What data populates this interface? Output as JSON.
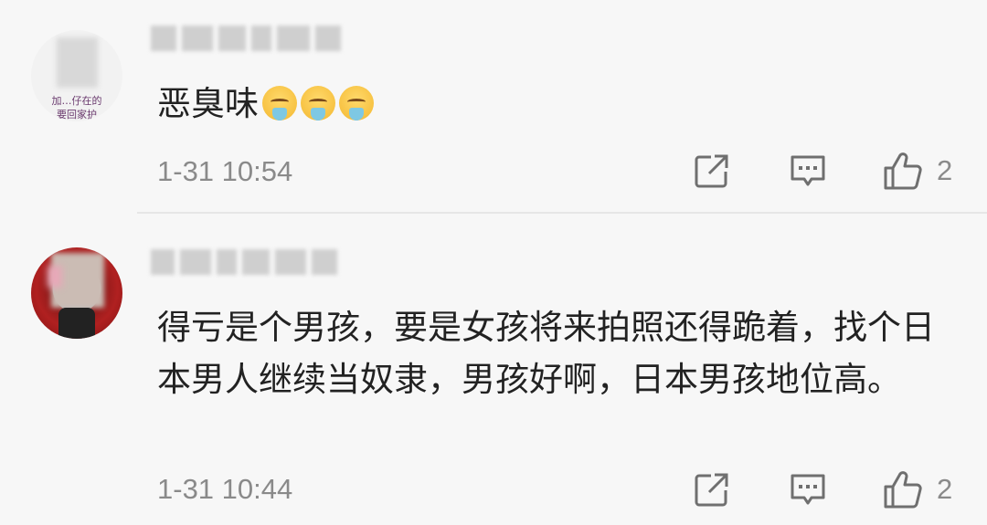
{
  "comments": [
    {
      "avatar_text_line1": "加…仔在的",
      "avatar_text_line2": "…要回家护…",
      "content": "恶臭味",
      "emoji": "vomit-emoji",
      "timestamp": "1-31 10:54",
      "likes": "2",
      "icons": {
        "share": "share-icon",
        "reply": "comment-icon",
        "like": "thumbs-up-icon"
      }
    },
    {
      "content": "得亏是个男孩，要是女孩将来拍照还得跪着，找个日本男人继续当奴隶，男孩好啊，日本男孩地位高。",
      "timestamp": "1-31 10:44",
      "likes": "2",
      "icons": {
        "share": "share-icon",
        "reply": "comment-icon",
        "like": "thumbs-up-icon"
      }
    }
  ],
  "colors": {
    "background": "#f7f7f7",
    "text": "#222222",
    "meta": "#8a8a8a",
    "icon": "#6f6f6f",
    "divider": "#e6e6e6"
  }
}
